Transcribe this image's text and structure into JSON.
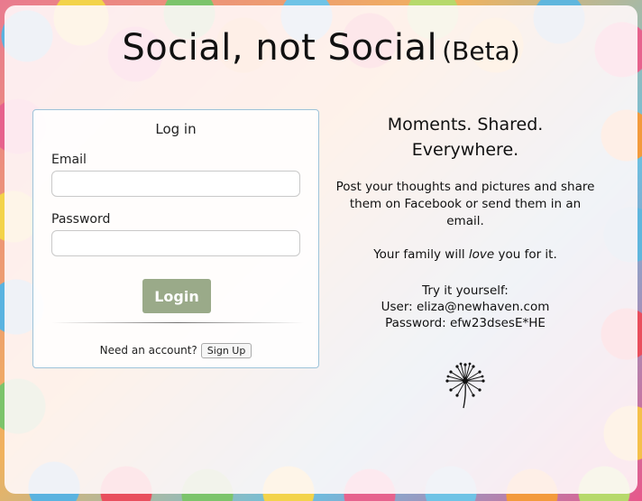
{
  "header": {
    "title": "Social, not Social",
    "beta": "(Beta)"
  },
  "login": {
    "heading": "Log in",
    "email_label": "Email",
    "email_value": "",
    "password_label": "Password",
    "password_value": "",
    "login_button": "Login",
    "need_account": "Need an account?",
    "signup_button": "Sign Up"
  },
  "info": {
    "headline_line1": "Moments. Shared.",
    "headline_line2": "Everywhere.",
    "blurb_line1": "Post your thoughts and pictures and share",
    "blurb_line2": "them on Facebook or send them in an",
    "blurb_line3": "email.",
    "family_prefix": "Your family will ",
    "family_emph": "love",
    "family_suffix": " you for it.",
    "try_line1": "Try it yourself:",
    "try_line2": "User: eliza@newhaven.com",
    "try_line3": "Password: efw23dsesE*HE"
  },
  "icons": {
    "logo": "dandelion-icon"
  },
  "colors": {
    "login_button_bg": "#9aaa89",
    "card_border": "#9dc3d9"
  }
}
